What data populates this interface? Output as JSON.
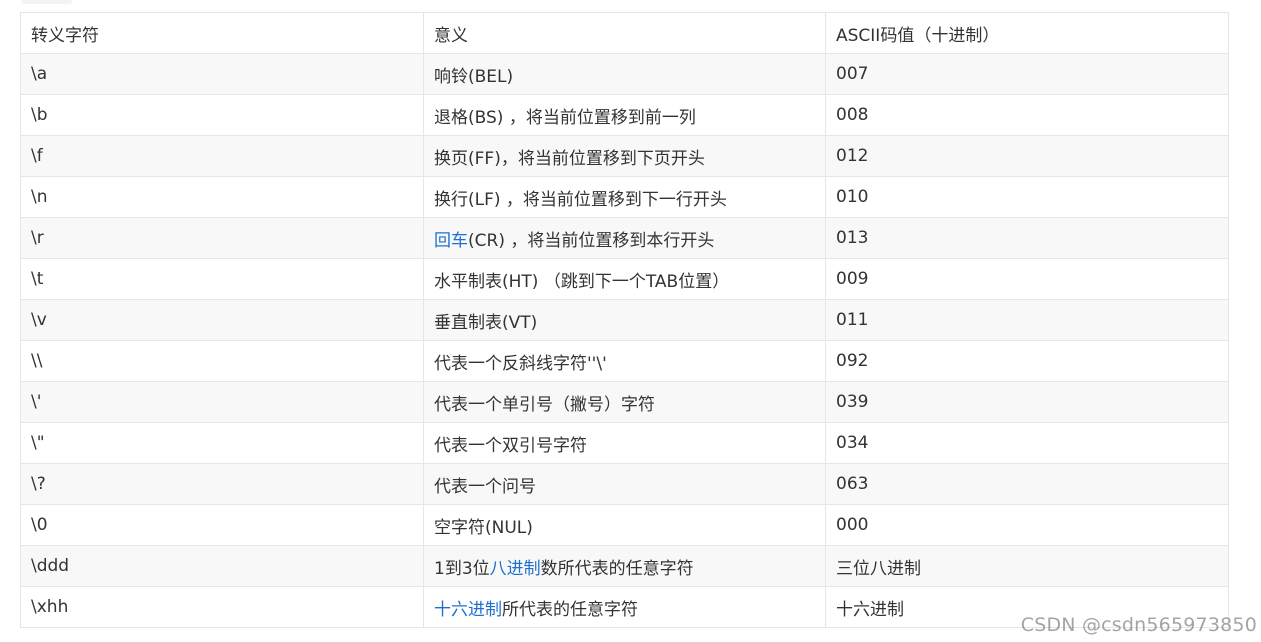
{
  "table": {
    "headers": [
      "转义字符",
      "意义",
      "ASCII码值（十进制）"
    ],
    "rows": [
      {
        "escape": "\\a",
        "meaning": [
          {
            "t": "响铃(BEL)"
          }
        ],
        "ascii": "007"
      },
      {
        "escape": "\\b",
        "meaning": [
          {
            "t": "退格(BS) ，将当前位置移到前一列"
          }
        ],
        "ascii": "008"
      },
      {
        "escape": "\\f",
        "meaning": [
          {
            "t": "换页(FF)，将当前位置移到下页开头"
          }
        ],
        "ascii": "012"
      },
      {
        "escape": "\\n",
        "meaning": [
          {
            "t": "换行(LF) ，将当前位置移到下一行开头"
          }
        ],
        "ascii": "010"
      },
      {
        "escape": "\\r",
        "meaning": [
          {
            "t": "回车",
            "link": true
          },
          {
            "t": "(CR) ，将当前位置移到本行开头"
          }
        ],
        "ascii": "013"
      },
      {
        "escape": "\\t",
        "meaning": [
          {
            "t": "水平制表(HT) （跳到下一个TAB位置）"
          }
        ],
        "ascii": "009"
      },
      {
        "escape": "\\v",
        "meaning": [
          {
            "t": "垂直制表(VT)"
          }
        ],
        "ascii": "011"
      },
      {
        "escape": "\\\\",
        "meaning": [
          {
            "t": "代表一个反斜线字符''\\'"
          }
        ],
        "ascii": "092"
      },
      {
        "escape": "\\'",
        "meaning": [
          {
            "t": "代表一个单引号（撇号）字符"
          }
        ],
        "ascii": "039"
      },
      {
        "escape": "\\\"",
        "meaning": [
          {
            "t": "代表一个双引号字符"
          }
        ],
        "ascii": "034"
      },
      {
        "escape": "\\?",
        "meaning": [
          {
            "t": "代表一个问号"
          }
        ],
        "ascii": "063"
      },
      {
        "escape": "\\0",
        "meaning": [
          {
            "t": "空字符(NUL)"
          }
        ],
        "ascii": "000"
      },
      {
        "escape": "\\ddd",
        "meaning": [
          {
            "t": "1到3位"
          },
          {
            "t": "八进制",
            "link": true
          },
          {
            "t": "数所代表的任意字符"
          }
        ],
        "ascii": "三位八进制"
      },
      {
        "escape": "\\xhh",
        "meaning": [
          {
            "t": "十六进制",
            "link": true
          },
          {
            "t": "所代表的任意字符"
          }
        ],
        "ascii": "十六进制"
      }
    ]
  },
  "colors": {
    "link": "#1f6fce",
    "border": "#e4e6ea",
    "stripe": "#f8f8f8"
  },
  "watermark": "CSDN @csdn565973850"
}
